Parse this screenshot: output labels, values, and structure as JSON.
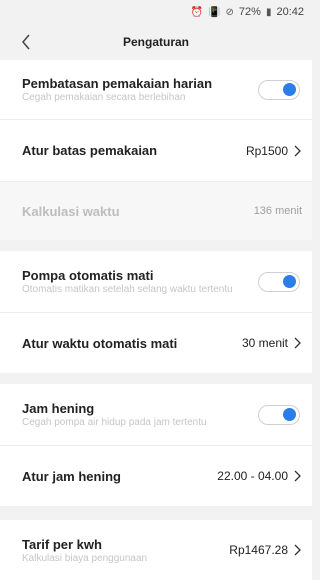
{
  "status": {
    "battery": "72%",
    "time": "20:42"
  },
  "appbar": {
    "title": "Pengaturan"
  },
  "section1": {
    "daily_limit": {
      "label": "Pembatasan pemakaian harian",
      "sub": "Cegah pemakaian secara berlebihan",
      "enabled": true
    },
    "set_limit": {
      "label": "Atur batas pemakaian",
      "value": "Rp1500"
    },
    "time_calc": {
      "label": "Kalkulasi waktu",
      "value": "136 menit"
    }
  },
  "section2": {
    "auto_off": {
      "label": "Pompa otomatis mati",
      "sub": "Otomatis matikan setelah selang waktu tertentu",
      "enabled": true
    },
    "auto_off_time": {
      "label": "Atur waktu otomatis mati",
      "value": "30 menit"
    }
  },
  "section3": {
    "quiet": {
      "label": "Jam hening",
      "sub": "Cegah pompa air hidup pada jam tertentu",
      "enabled": true
    },
    "quiet_time": {
      "label": "Atur jam hening",
      "value": "22.00 - 04.00"
    }
  },
  "section4": {
    "tariff": {
      "label": "Tarif per kwh",
      "sub": "Kalkulasi biaya penggunaan",
      "value": "Rp1467.28"
    }
  },
  "colors": {
    "accent": "#2b7de9",
    "background": "#f2f2f2"
  },
  "icons": {
    "back": "chevron-left-icon",
    "row_arrow": "chevron-right-icon",
    "alarm": "alarm-icon",
    "vibrate": "vibrate-icon",
    "no_disturb": "do-not-disturb-icon",
    "battery": "battery-icon"
  }
}
